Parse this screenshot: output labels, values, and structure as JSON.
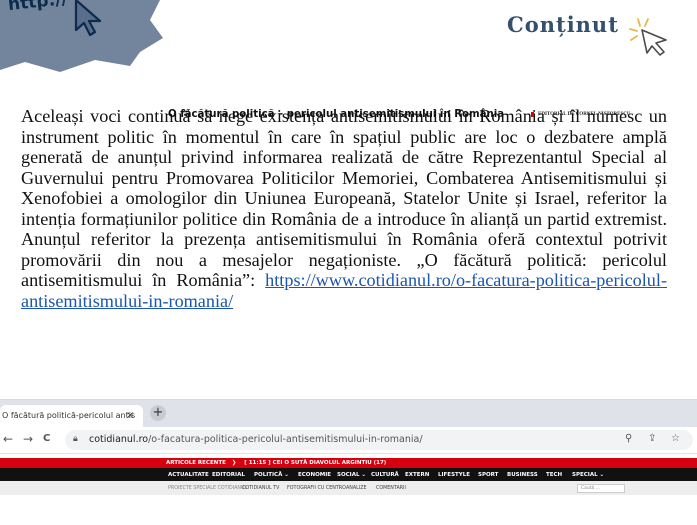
{
  "decoration": {
    "http_label": "http://",
    "brush_color": "#5a6e8c"
  },
  "heading": "Conținut",
  "paragraph": {
    "text": "Aceleași voci continuă să nege existența antisemitismului în  România și îl numesc un instrument politic în momentul în care în spațiul public are loc o dezbatere amplă generată de anunțul privind informarea realizată de către Reprezentantul Special al Guvernului pentru Promovarea Politicilor Memoriei, Combaterea Antisemitismului și Xenofobiei a omologilor din Uniunea Europeană, Statelor Unite și Israel, referitor la intenția formațiunilor politice din România de a introduce în alianță un partid extremist. Anunțul referitor la prezența antisemitismului în România oferă contextul potrivit promovării din nou a mesajelor negaționiste. „O făcătură politică: pericolul antisemitismului în România”: ",
    "link": "https://www.cotidianul.ro/o-facatura-politica-pericolul-antisemitismului-in-romania/"
  },
  "browser": {
    "tab_title": "O făcătură politică-pericolul antis",
    "tab_close": "×",
    "new_tab": "+",
    "nav": {
      "back": "←",
      "forward": "→",
      "reload": "C",
      "home": "⌂"
    },
    "url_domain": "cotidianul.ro",
    "url_path": "/o-facatura-politica-pericolul-antisemitismului-in-romania/",
    "url_icons": [
      "⚲",
      "⇪",
      "☆"
    ]
  },
  "site": {
    "breaking_label": "ARTICOLE RECENTE",
    "breaking_text": "[ 11:15 ]  CEI O SUTĂ DIAVOLUL ARGINTIU (17)",
    "menu": [
      "ACTUALITATE",
      "EDITORIAL",
      "POLITICĂ ⌄",
      "ECONOMIE",
      "SOCIAL ⌄",
      "CULTURĂ",
      "EXTERN",
      "LIFESTYLE",
      "SPORT",
      "BUSINESS",
      "TECH",
      "SPECIAL ⌄"
    ],
    "submenu": [
      "PROIECTE SPECIALE COTIDIANUL:",
      "COTIDIANUL TV",
      "FOTOGRAFII CU CENTRO",
      "ANALIZE",
      "COMENTARII"
    ],
    "search_placeholder": "Caută ...",
    "article_title": "O făcătură politică – pericolul antisemitismului în România",
    "editorial_label": "EDITORIAL DE CORNEL NISTORESCU"
  }
}
